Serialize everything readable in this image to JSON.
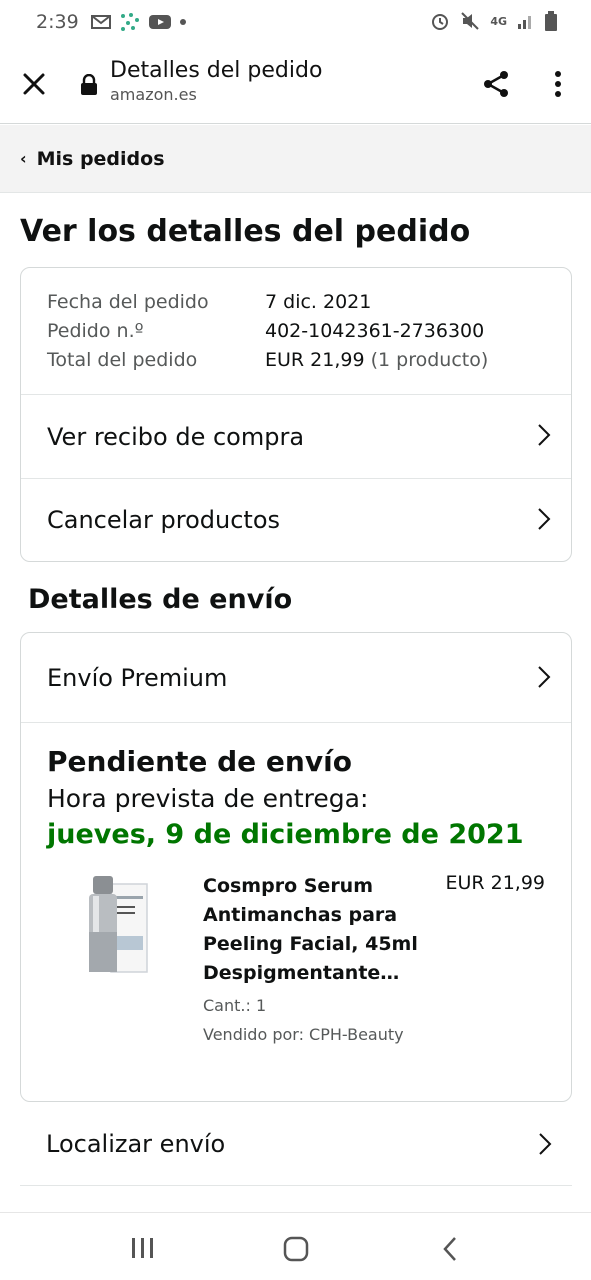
{
  "status_bar": {
    "time": "2:39",
    "network": "4G"
  },
  "browser": {
    "title": "Detalles del pedido",
    "domain": "amazon.es"
  },
  "breadcrumb": {
    "label": "Mis pedidos"
  },
  "heading": "Ver los detalles del pedido",
  "order_summary": {
    "date_label": "Fecha del pedido",
    "date_value": "7 dic. 2021",
    "number_label": "Pedido n.º",
    "number_value": "402-1042361-2736300",
    "total_label": "Total del pedido",
    "total_value": "EUR 21,99",
    "total_count": "(1 producto)"
  },
  "actions": {
    "receipt": "Ver recibo de compra",
    "cancel": "Cancelar productos"
  },
  "shipping": {
    "section_title": "Detalles de envío",
    "method": "Envío Premium",
    "status": "Pendiente de envío",
    "eta_label": "Hora prevista de entrega:",
    "eta_date": "jueves, 9 de diciembre de 2021"
  },
  "product": {
    "title": "Cosmpro Serum Antimanchas para Peeling Facial, 45ml Despigmentante…",
    "price": "EUR 21,99",
    "qty": "Cant.: 1",
    "seller": "Vendido por: CPH-Beauty"
  },
  "track": {
    "label": "Localizar envío"
  },
  "colors": {
    "delivery_green": "#007600",
    "text": "#0f1111",
    "muted": "#565959",
    "breadcrumb_bg": "#f3f3f3"
  }
}
